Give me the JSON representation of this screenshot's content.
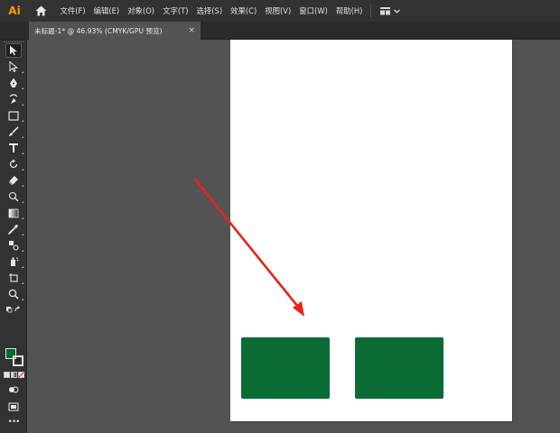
{
  "app": {
    "logo_text": "Ai"
  },
  "menu": {
    "items": [
      "文件(F)",
      "编辑(E)",
      "对象(O)",
      "文字(T)",
      "选择(S)",
      "效果(C)",
      "视图(V)",
      "窗口(W)",
      "帮助(H)"
    ],
    "workspace_icon": "grid-icon",
    "workspace_chevron": "chevron-down-icon"
  },
  "document": {
    "tab_label": "未标题-1* @ 46.93% (CMYK/GPU 预览)",
    "close_glyph": "×"
  },
  "toolbar": {
    "tools": [
      "selection-tool",
      "direct-selection-tool",
      "pen-tool",
      "curvature-tool",
      "rectangle-tool",
      "paintbrush-tool",
      "type-tool",
      "rotate-tool",
      "eraser-tool",
      "shape-builder-tool",
      "gradient-tool",
      "eyedropper-tool",
      "blend-tool",
      "symbol-sprayer-tool",
      "artboard-tool",
      "zoom-tool"
    ],
    "active_tool": "selection-tool",
    "more_glyph": "•••"
  },
  "colors": {
    "fill": "#006837",
    "rect_fill": "#0b6b35",
    "arrow": "#e8231e",
    "artboard": "#ffffff"
  }
}
